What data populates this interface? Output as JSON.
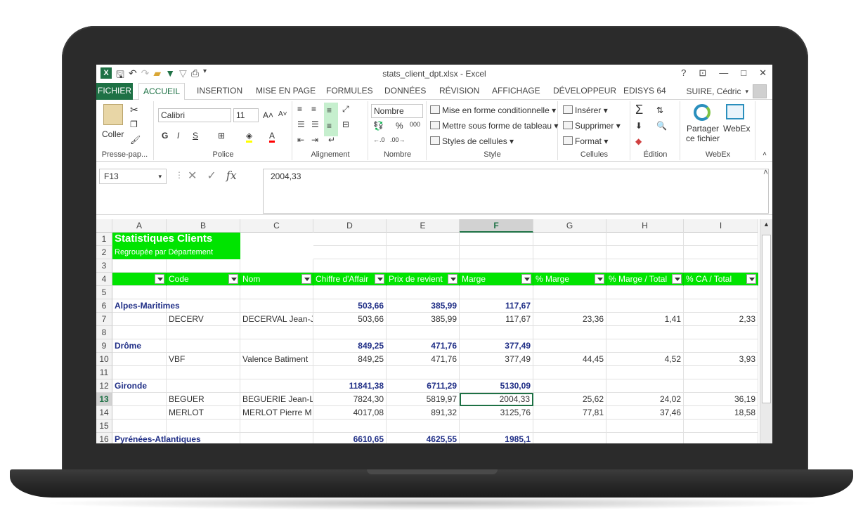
{
  "window": {
    "title": "stats_client_dpt.xlsx - Excel",
    "help": "?",
    "minimize": "—",
    "maximize": "□",
    "close": "✕"
  },
  "tabs": [
    "FICHIER",
    "ACCUEIL",
    "INSERTION",
    "MISE EN PAGE",
    "FORMULES",
    "DONNÉES",
    "RÉVISION",
    "AFFICHAGE",
    "DÉVELOPPEUR",
    "EDISYS 64"
  ],
  "user": "SUIRE, Cédric",
  "ribbon": {
    "clipboard": {
      "paste": "Coller",
      "label": "Presse-pap..."
    },
    "font": {
      "name": "Calibri",
      "size": "11",
      "bold": "G",
      "italic": "I",
      "underline": "S",
      "grow": "A˄",
      "shrink": "A˅",
      "label": "Police"
    },
    "alignment": {
      "label": "Alignement"
    },
    "number": {
      "format": "Nombre",
      "percent": "%",
      "thousands": "000",
      "label": "Nombre"
    },
    "style": {
      "cond": "Mise en forme conditionnelle",
      "table": "Mettre sous forme de tableau",
      "cell": "Styles de cellules",
      "label": "Style"
    },
    "cells": {
      "insert": "Insérer",
      "delete": "Supprimer",
      "format": "Format",
      "label": "Cellules"
    },
    "edit": {
      "sum": "Σ",
      "label": "Édition"
    },
    "webex": {
      "share": "Partager ce fichier",
      "webex": "WebEx",
      "label": "WebEx"
    }
  },
  "formula_bar": {
    "cell": "F13",
    "fx": "fx",
    "value": "2004,33"
  },
  "columns": [
    "A",
    "B",
    "C",
    "D",
    "E",
    "F",
    "G",
    "H",
    "I"
  ],
  "selected_column": "F",
  "selected_row": "13",
  "sheet": {
    "title": "Statistiques Clients",
    "subtitle": "Regroupée par Département",
    "headers": [
      "",
      "Code",
      "Nom",
      "Chiffre d'Affair",
      "Prix de revient",
      "Marge",
      "% Marge",
      "% Marge / Total",
      "% CA / Total"
    ],
    "rows": [
      {
        "n": "5",
        "cells": [
          "",
          "",
          "",
          "",
          "",
          "",
          "",
          "",
          ""
        ]
      },
      {
        "n": "6",
        "group": true,
        "cells": [
          "Alpes-Maritimes",
          "",
          "",
          "503,66",
          "385,99",
          "117,67",
          "",
          "",
          ""
        ]
      },
      {
        "n": "7",
        "cells": [
          "",
          "DECERV",
          "DECERVAL Jean-Ja",
          "503,66",
          "385,99",
          "117,67",
          "23,36",
          "1,41",
          "2,33"
        ]
      },
      {
        "n": "8",
        "cells": [
          "",
          "",
          "",
          "",
          "",
          "",
          "",
          "",
          ""
        ]
      },
      {
        "n": "9",
        "group": true,
        "cells": [
          "Drôme",
          "",
          "",
          "849,25",
          "471,76",
          "377,49",
          "",
          "",
          ""
        ]
      },
      {
        "n": "10",
        "cells": [
          "",
          "VBF",
          "Valence Batiment",
          "849,25",
          "471,76",
          "377,49",
          "44,45",
          "4,52",
          "3,93"
        ]
      },
      {
        "n": "11",
        "cells": [
          "",
          "",
          "",
          "",
          "",
          "",
          "",
          "",
          ""
        ]
      },
      {
        "n": "12",
        "group": true,
        "cells": [
          "Gironde",
          "",
          "",
          "11841,38",
          "6711,29",
          "5130,09",
          "",
          "",
          ""
        ]
      },
      {
        "n": "13",
        "cells": [
          "",
          "BEGUER",
          "BEGUERIE Jean-Lo",
          "7824,30",
          "5819,97",
          "2004,33",
          "25,62",
          "24,02",
          "36,19"
        ]
      },
      {
        "n": "14",
        "cells": [
          "",
          "MERLOT",
          "MERLOT Pierre M",
          "4017,08",
          "891,32",
          "3125,76",
          "77,81",
          "37,46",
          "18,58"
        ]
      },
      {
        "n": "15",
        "cells": [
          "",
          "",
          "",
          "",
          "",
          "",
          "",
          "",
          ""
        ]
      },
      {
        "n": "16",
        "group": true,
        "cells": [
          "Pyrénées-Atlantiques",
          "",
          "",
          "6610,65",
          "4625,55",
          "1985,1",
          "",
          "",
          ""
        ]
      }
    ]
  },
  "colors": {
    "excel_green": "#1e7145",
    "header_green": "#00e400",
    "group_blue": "#1f2e86"
  }
}
